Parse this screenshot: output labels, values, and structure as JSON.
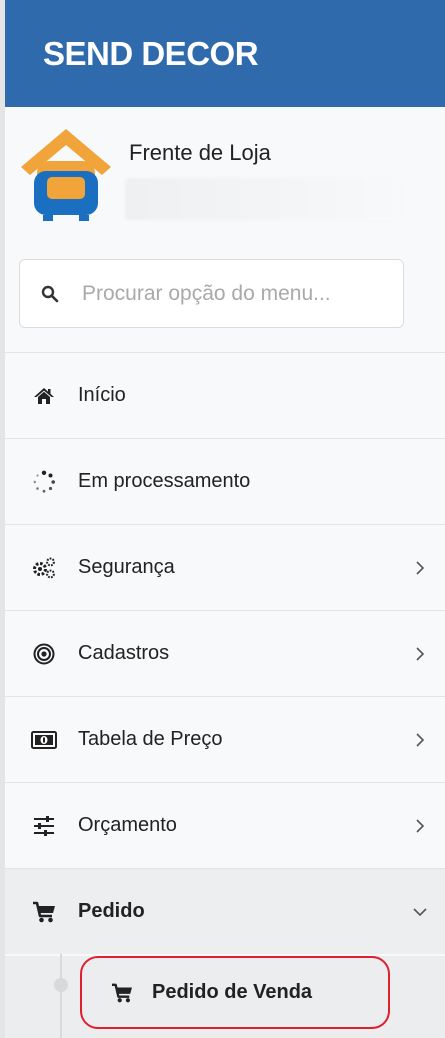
{
  "brand": {
    "title": "SEND DECOR",
    "color": "#2f6aad"
  },
  "user_panel": {
    "store_name": "Frente de Loja",
    "logo_icon": "armchair-house-icon"
  },
  "search": {
    "placeholder": "Procurar opção do menu...",
    "value": "",
    "icon": "search-icon"
  },
  "menu": {
    "items": [
      {
        "label": "Início",
        "icon": "home-icon",
        "has_children": false
      },
      {
        "label": "Em processamento",
        "icon": "spinner-icon",
        "has_children": false
      },
      {
        "label": "Segurança",
        "icon": "gears-icon",
        "has_children": true,
        "expanded": false
      },
      {
        "label": "Cadastros",
        "icon": "target-icon",
        "has_children": true,
        "expanded": false
      },
      {
        "label": "Tabela de Preço",
        "icon": "money-bill-icon",
        "has_children": true,
        "expanded": false
      },
      {
        "label": "Orçamento",
        "icon": "sliders-icon",
        "has_children": true,
        "expanded": false
      },
      {
        "label": "Pedido",
        "icon": "cart-icon",
        "has_children": true,
        "expanded": true
      }
    ],
    "submenu": [
      {
        "label": "Pedido de Venda",
        "icon": "cart-icon",
        "highlighted": true
      }
    ]
  },
  "colors": {
    "highlight_border": "#e0202e",
    "logo_blue": "#1a6fc0",
    "logo_orange": "#f0a43a"
  }
}
